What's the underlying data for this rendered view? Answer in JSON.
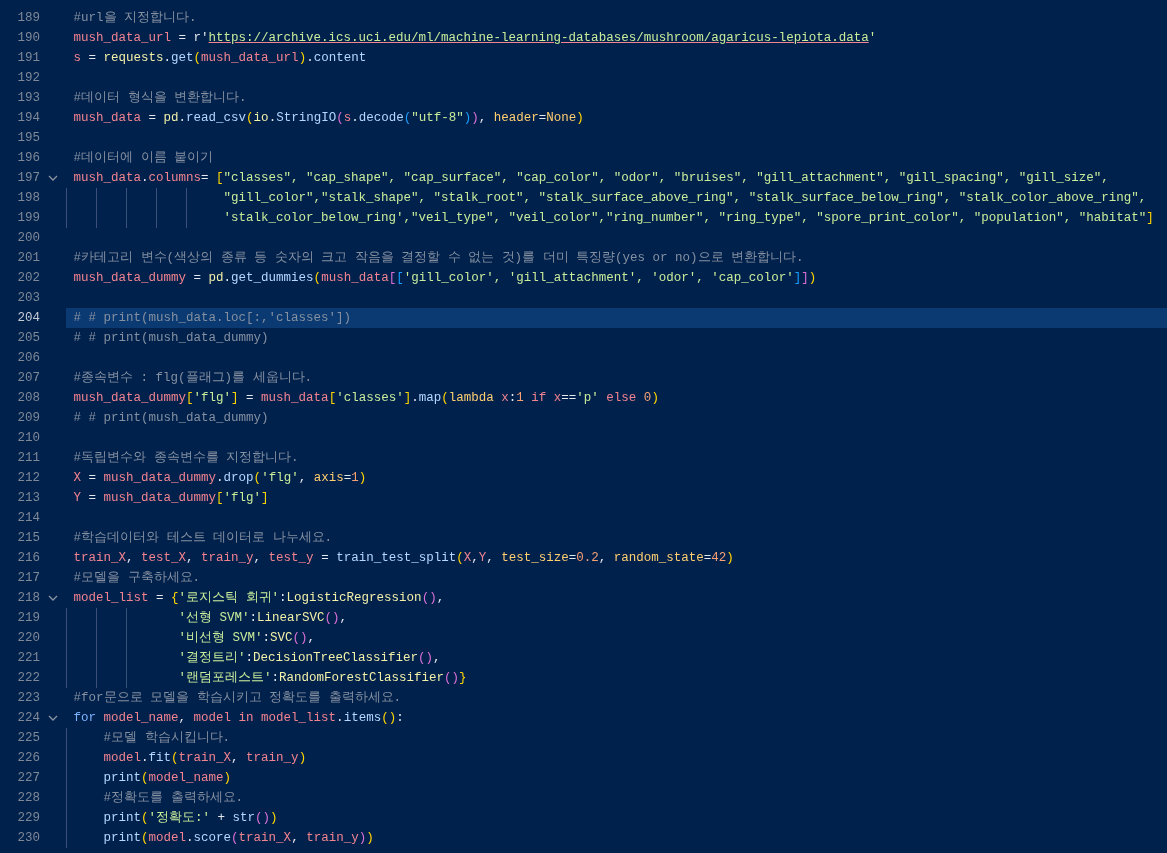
{
  "editor": {
    "lines": [
      {
        "number": "189",
        "foldable": false,
        "current": false,
        "segments": [
          {
            "t": "#url을 지정합니다.",
            "kind": "comment"
          }
        ]
      },
      {
        "number": "190",
        "foldable": false,
        "current": false,
        "segments": [
          {
            "t": "mush_data_url",
            "kind": "variable"
          },
          {
            "t": " = r'",
            "kind": "plain"
          },
          {
            "t": "https://archive.ics.uci.edu/ml/machine-learning-databases/mushroom/agaricus-lepiota.data",
            "kind": "url"
          },
          {
            "t": "'",
            "kind": "string"
          }
        ]
      },
      {
        "number": "191",
        "foldable": false,
        "current": false,
        "segments": [
          {
            "t": "s",
            "kind": "variable"
          },
          {
            "t": " = ",
            "kind": "plain"
          },
          {
            "t": "requests",
            "kind": "type"
          },
          {
            "t": ".",
            "kind": "plain"
          },
          {
            "t": "get",
            "kind": "function"
          },
          {
            "t": "(",
            "kind": "bracket"
          },
          {
            "t": "mush_data_url",
            "kind": "variable"
          },
          {
            "t": ")",
            "kind": "bracket"
          },
          {
            "t": ".",
            "kind": "plain"
          },
          {
            "t": "content",
            "kind": "function"
          }
        ]
      },
      {
        "number": "192",
        "foldable": false,
        "current": false
      },
      {
        "number": "193",
        "foldable": false,
        "current": false,
        "segments": [
          {
            "t": "#데이터 형식을 변환합니다.",
            "kind": "comment"
          }
        ]
      },
      {
        "number": "194",
        "foldable": false,
        "current": false,
        "segments": [
          {
            "t": "mush_data",
            "kind": "variable"
          },
          {
            "t": " = ",
            "kind": "plain"
          },
          {
            "t": "pd",
            "kind": "type"
          },
          {
            "t": ".",
            "kind": "plain"
          },
          {
            "t": "read_csv",
            "kind": "function"
          },
          {
            "t": "(",
            "kind": "bracket"
          },
          {
            "t": "io",
            "kind": "type"
          },
          {
            "t": ".",
            "kind": "plain"
          },
          {
            "t": "StringIO",
            "kind": "function"
          },
          {
            "t": "(",
            "kind": "nested"
          },
          {
            "t": "s",
            "kind": "variable"
          },
          {
            "t": ".",
            "kind": "plain"
          },
          {
            "t": "decode",
            "kind": "function"
          },
          {
            "t": "(",
            "kind": "inner"
          },
          {
            "t": "\"utf-8\"",
            "kind": "string"
          },
          {
            "t": ")",
            "kind": "inner"
          },
          {
            "t": ")",
            "kind": "nested"
          },
          {
            "t": ", ",
            "kind": "plain"
          },
          {
            "t": "header",
            "kind": "parameter"
          },
          {
            "t": "=",
            "kind": "plain"
          },
          {
            "t": "None",
            "kind": "parameter"
          },
          {
            "t": ")",
            "kind": "bracket"
          }
        ]
      },
      {
        "number": "195",
        "foldable": false,
        "current": false
      },
      {
        "number": "196",
        "foldable": false,
        "current": false,
        "segments": [
          {
            "t": "#데이터에 이름 붙이기",
            "kind": "comment"
          }
        ]
      },
      {
        "number": "197",
        "foldable": true,
        "current": false,
        "segments": [
          {
            "t": "mush_data",
            "kind": "variable"
          },
          {
            "t": ".",
            "kind": "plain"
          },
          {
            "t": "columns",
            "kind": "variable"
          },
          {
            "t": "= ",
            "kind": "plain"
          },
          {
            "t": "[",
            "kind": "bracket"
          },
          {
            "t": "\"classes\", \"cap_shape\", \"cap_surface\", \"cap_color\", \"odor\", \"bruises\", \"gill_attachment\", \"gill_spacing\", \"gill_size\",",
            "kind": "string"
          }
        ]
      },
      {
        "number": "198",
        "foldable": false,
        "current": false,
        "segments": [
          {
            "t": "                    \"gill_color\",\"stalk_shape\", \"stalk_root\", \"stalk_surface_above_ring\", \"stalk_surface_below_ring\", \"stalk_color_above_ring\",",
            "kind": "string"
          }
        ]
      },
      {
        "number": "199",
        "foldable": false,
        "current": false,
        "segments": [
          {
            "t": "                    'stalk_color_below_ring',\"veil_type\", \"veil_color\",\"ring_number\", \"ring_type\", \"spore_print_color\", \"population\", \"habitat\"",
            "kind": "string"
          },
          {
            "t": "]",
            "kind": "bracket"
          }
        ]
      },
      {
        "number": "200",
        "foldable": false,
        "current": false
      },
      {
        "number": "201",
        "foldable": false,
        "current": false,
        "segments": [
          {
            "t": "#카테고리 변수(색상의 종류 등 숫자의 크고 작음을 결정할 수 없는 것)를 더미 특징량(yes or no)으로 변환합니다.",
            "kind": "comment"
          }
        ]
      },
      {
        "number": "202",
        "foldable": false,
        "current": false,
        "segments": [
          {
            "t": "mush_data_dummy",
            "kind": "variable"
          },
          {
            "t": " = ",
            "kind": "plain"
          },
          {
            "t": "pd",
            "kind": "type"
          },
          {
            "t": ".",
            "kind": "plain"
          },
          {
            "t": "get_dummies",
            "kind": "function"
          },
          {
            "t": "(",
            "kind": "bracket"
          },
          {
            "t": "mush_data",
            "kind": "variable"
          },
          {
            "t": "[",
            "kind": "nested"
          },
          {
            "t": "[",
            "kind": "inner"
          },
          {
            "t": "'gill_color', 'gill_attachment', 'odor', 'cap_color'",
            "kind": "string"
          },
          {
            "t": "]",
            "kind": "inner"
          },
          {
            "t": "]",
            "kind": "nested"
          },
          {
            "t": ")",
            "kind": "bracket"
          }
        ]
      },
      {
        "number": "203",
        "foldable": false,
        "current": false
      },
      {
        "number": "204",
        "foldable": false,
        "current": true,
        "segments": [
          {
            "t": "# # print(mush_data.loc[:,'classes'])",
            "kind": "comment"
          }
        ]
      },
      {
        "number": "205",
        "foldable": false,
        "current": false,
        "segments": [
          {
            "t": "# # print(mush_data_dummy)",
            "kind": "comment"
          }
        ]
      },
      {
        "number": "206",
        "foldable": false,
        "current": false
      },
      {
        "number": "207",
        "foldable": false,
        "current": false,
        "segments": [
          {
            "t": "#종속변수 : flg(플래그)를 세웁니다.",
            "kind": "comment"
          }
        ]
      },
      {
        "number": "208",
        "foldable": false,
        "current": false,
        "segments": [
          {
            "t": "mush_data_dummy",
            "kind": "variable"
          },
          {
            "t": "[",
            "kind": "bracket"
          },
          {
            "t": "'flg'",
            "kind": "string"
          },
          {
            "t": "]",
            "kind": "bracket"
          },
          {
            "t": " = ",
            "kind": "plain"
          },
          {
            "t": "mush_data",
            "kind": "variable"
          },
          {
            "t": "[",
            "kind": "bracket"
          },
          {
            "t": "'classes'",
            "kind": "string"
          },
          {
            "t": "]",
            "kind": "bracket"
          },
          {
            "t": ".",
            "kind": "plain"
          },
          {
            "t": "map",
            "kind": "function"
          },
          {
            "t": "(",
            "kind": "bracket"
          },
          {
            "t": "lambda",
            "kind": "lambda"
          },
          {
            "t": " x",
            "kind": "variable"
          },
          {
            "t": ":",
            "kind": "plain"
          },
          {
            "t": "1",
            "kind": "number"
          },
          {
            "t": " if",
            "kind": "control"
          },
          {
            "t": " x",
            "kind": "variable"
          },
          {
            "t": "==",
            "kind": "plain"
          },
          {
            "t": "'p'",
            "kind": "string"
          },
          {
            "t": " else",
            "kind": "control"
          },
          {
            "t": " 0",
            "kind": "number"
          },
          {
            "t": ")",
            "kind": "bracket"
          }
        ]
      },
      {
        "number": "209",
        "foldable": false,
        "current": false,
        "segments": [
          {
            "t": "# # print(mush_data_dummy)",
            "kind": "comment"
          }
        ]
      },
      {
        "number": "210",
        "foldable": false,
        "current": false
      },
      {
        "number": "211",
        "foldable": false,
        "current": false,
        "segments": [
          {
            "t": "#독립변수와 종속변수를 지정합니다.",
            "kind": "comment"
          }
        ]
      },
      {
        "number": "212",
        "foldable": false,
        "current": false,
        "segments": [
          {
            "t": "X",
            "kind": "variable"
          },
          {
            "t": " = ",
            "kind": "plain"
          },
          {
            "t": "mush_data_dummy",
            "kind": "variable"
          },
          {
            "t": ".",
            "kind": "plain"
          },
          {
            "t": "drop",
            "kind": "function"
          },
          {
            "t": "(",
            "kind": "bracket"
          },
          {
            "t": "'flg'",
            "kind": "string"
          },
          {
            "t": ", ",
            "kind": "plain"
          },
          {
            "t": "axis",
            "kind": "parameter"
          },
          {
            "t": "=",
            "kind": "plain"
          },
          {
            "t": "1",
            "kind": "number"
          },
          {
            "t": ")",
            "kind": "bracket"
          }
        ]
      },
      {
        "number": "213",
        "foldable": false,
        "current": false,
        "segments": [
          {
            "t": "Y",
            "kind": "variable"
          },
          {
            "t": " = ",
            "kind": "plain"
          },
          {
            "t": "mush_data_dummy",
            "kind": "variable"
          },
          {
            "t": "[",
            "kind": "bracket"
          },
          {
            "t": "'flg'",
            "kind": "string"
          },
          {
            "t": "]",
            "kind": "bracket"
          }
        ]
      },
      {
        "number": "214",
        "foldable": false,
        "current": false
      },
      {
        "number": "215",
        "foldable": false,
        "current": false,
        "segments": [
          {
            "t": "#학습데이터와 테스트 데이터로 나누세요.",
            "kind": "comment"
          }
        ]
      },
      {
        "number": "216",
        "foldable": false,
        "current": false,
        "segments": [
          {
            "t": "train_X",
            "kind": "variable"
          },
          {
            "t": ", ",
            "kind": "plain"
          },
          {
            "t": "test_X",
            "kind": "variable"
          },
          {
            "t": ", ",
            "kind": "plain"
          },
          {
            "t": "train_y",
            "kind": "variable"
          },
          {
            "t": ", ",
            "kind": "plain"
          },
          {
            "t": "test_y",
            "kind": "variable"
          },
          {
            "t": " = ",
            "kind": "plain"
          },
          {
            "t": "train_test_split",
            "kind": "function"
          },
          {
            "t": "(",
            "kind": "bracket"
          },
          {
            "t": "X",
            "kind": "variable"
          },
          {
            "t": ",",
            "kind": "plain"
          },
          {
            "t": "Y",
            "kind": "variable"
          },
          {
            "t": ", ",
            "kind": "plain"
          },
          {
            "t": "test_size",
            "kind": "parameter"
          },
          {
            "t": "=",
            "kind": "plain"
          },
          {
            "t": "0.2",
            "kind": "number"
          },
          {
            "t": ", ",
            "kind": "plain"
          },
          {
            "t": "random_state",
            "kind": "parameter"
          },
          {
            "t": "=",
            "kind": "plain"
          },
          {
            "t": "42",
            "kind": "number"
          },
          {
            "t": ")",
            "kind": "bracket"
          }
        ]
      },
      {
        "number": "217",
        "foldable": false,
        "current": false,
        "segments": [
          {
            "t": "#모델을 구축하세요.",
            "kind": "comment"
          }
        ]
      },
      {
        "number": "218",
        "foldable": true,
        "current": false,
        "segments": [
          {
            "t": "model_list",
            "kind": "variable"
          },
          {
            "t": " = ",
            "kind": "plain"
          },
          {
            "t": "{",
            "kind": "bracket"
          },
          {
            "t": "'로지스틱 회귀'",
            "kind": "string"
          },
          {
            "t": ":",
            "kind": "plain"
          },
          {
            "t": "LogisticRegression",
            "kind": "type"
          },
          {
            "t": "()",
            "kind": "nested"
          },
          {
            "t": ",",
            "kind": "plain"
          }
        ]
      },
      {
        "number": "219",
        "foldable": false,
        "current": false,
        "segments": [
          {
            "t": "              '선형 SVM'",
            "kind": "string"
          },
          {
            "t": ":",
            "kind": "plain"
          },
          {
            "t": "LinearSVC",
            "kind": "type"
          },
          {
            "t": "()",
            "kind": "nested"
          },
          {
            "t": ",",
            "kind": "plain"
          }
        ]
      },
      {
        "number": "220",
        "foldable": false,
        "current": false,
        "segments": [
          {
            "t": "              '비선형 SVM'",
            "kind": "string"
          },
          {
            "t": ":",
            "kind": "plain"
          },
          {
            "t": "SVC",
            "kind": "type"
          },
          {
            "t": "()",
            "kind": "nested"
          },
          {
            "t": ",",
            "kind": "plain"
          }
        ]
      },
      {
        "number": "221",
        "foldable": false,
        "current": false,
        "segments": [
          {
            "t": "              '결정트리'",
            "kind": "string"
          },
          {
            "t": ":",
            "kind": "plain"
          },
          {
            "t": "DecisionTreeClassifier",
            "kind": "type"
          },
          {
            "t": "()",
            "kind": "nested"
          },
          {
            "t": ",",
            "kind": "plain"
          }
        ]
      },
      {
        "number": "222",
        "foldable": false,
        "current": false,
        "segments": [
          {
            "t": "              '랜덤포레스트'",
            "kind": "string"
          },
          {
            "t": ":",
            "kind": "plain"
          },
          {
            "t": "RandomForestClassifier",
            "kind": "type"
          },
          {
            "t": "()",
            "kind": "nested"
          },
          {
            "t": "}",
            "kind": "bracket"
          }
        ]
      },
      {
        "number": "223",
        "foldable": false,
        "current": false,
        "segments": [
          {
            "t": "#for문으로 모델을 학습시키고 정확도를 출력하세요.",
            "kind": "comment"
          }
        ]
      },
      {
        "number": "224",
        "foldable": true,
        "current": false,
        "segments": [
          {
            "t": "for",
            "kind": "keyword"
          },
          {
            "t": " model_name",
            "kind": "variable"
          },
          {
            "t": ", ",
            "kind": "plain"
          },
          {
            "t": "model",
            "kind": "variable"
          },
          {
            "t": " in",
            "kind": "control"
          },
          {
            "t": " model_list",
            "kind": "variable"
          },
          {
            "t": ".",
            "kind": "plain"
          },
          {
            "t": "items",
            "kind": "function"
          },
          {
            "t": "()",
            "kind": "bracket"
          },
          {
            "t": ":",
            "kind": "plain"
          }
        ]
      },
      {
        "number": "225",
        "foldable": false,
        "current": false,
        "segments": [
          {
            "t": "    #모델 학습시킵니다.",
            "kind": "comment"
          }
        ]
      },
      {
        "number": "226",
        "foldable": false,
        "current": false,
        "segments": [
          {
            "t": "    model",
            "kind": "variable"
          },
          {
            "t": ".",
            "kind": "plain"
          },
          {
            "t": "fit",
            "kind": "function"
          },
          {
            "t": "(",
            "kind": "bracket"
          },
          {
            "t": "train_X",
            "kind": "variable"
          },
          {
            "t": ", ",
            "kind": "plain"
          },
          {
            "t": "train_y",
            "kind": "variable"
          },
          {
            "t": ")",
            "kind": "bracket"
          }
        ]
      },
      {
        "number": "227",
        "foldable": false,
        "current": false,
        "segments": [
          {
            "t": "    print",
            "kind": "function"
          },
          {
            "t": "(",
            "kind": "bracket"
          },
          {
            "t": "model_name",
            "kind": "variable"
          },
          {
            "t": ")",
            "kind": "bracket"
          }
        ]
      },
      {
        "number": "228",
        "foldable": false,
        "current": false,
        "segments": [
          {
            "t": "    #정확도를 출력하세요.",
            "kind": "comment"
          }
        ]
      },
      {
        "number": "229",
        "foldable": false,
        "current": false,
        "segments": [
          {
            "t": "    print",
            "kind": "function"
          },
          {
            "t": "(",
            "kind": "bracket"
          },
          {
            "t": "'정확도:'",
            "kind": "string"
          },
          {
            "t": " + ",
            "kind": "plain"
          },
          {
            "t": "str",
            "kind": "function"
          },
          {
            "t": "()",
            "kind": "nested"
          },
          {
            "t": ")",
            "kind": "bracket"
          }
        ]
      },
      {
        "number": "230",
        "foldable": false,
        "current": false,
        "segments": [
          {
            "t": "    print",
            "kind": "function"
          },
          {
            "t": "(",
            "kind": "bracket"
          },
          {
            "t": "model",
            "kind": "variable"
          },
          {
            "t": ".",
            "kind": "plain"
          },
          {
            "t": "score",
            "kind": "function"
          },
          {
            "t": "(",
            "kind": "nested"
          },
          {
            "t": "train_X",
            "kind": "variable"
          },
          {
            "t": ", ",
            "kind": "plain"
          },
          {
            "t": "train_y",
            "kind": "variable"
          },
          {
            "t": ")",
            "kind": "nested"
          },
          {
            "t": ")",
            "kind": "bracket"
          }
        ]
      }
    ]
  }
}
